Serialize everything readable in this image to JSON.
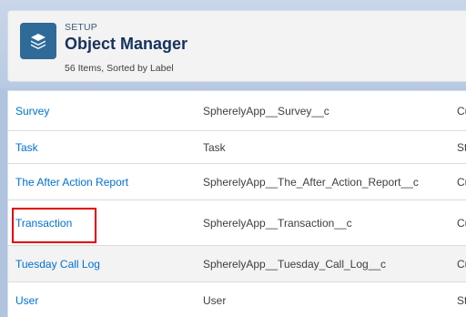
{
  "header": {
    "setup_label": "SETUP",
    "title": "Object Manager",
    "item_count": "56 Items, Sorted by Label",
    "icon": "layers-icon",
    "icon_color": "#2f6a98"
  },
  "rows": [
    {
      "label": "Survey",
      "api_name": "SpherelyApp__Survey__c",
      "type": "Cu"
    },
    {
      "label": "Task",
      "api_name": "Task",
      "type": "St"
    },
    {
      "label": "The After Action Report",
      "api_name": "SpherelyApp__The_After_Action_Report__c",
      "type": "Cu"
    },
    {
      "label": "Transaction",
      "api_name": "SpherelyApp__Transaction__c",
      "type": "Cu"
    },
    {
      "label": "Tuesday Call Log",
      "api_name": "SpherelyApp__Tuesday_Call_Log__c",
      "type": "Cu"
    },
    {
      "label": "User",
      "api_name": "User",
      "type": "St"
    }
  ],
  "colors": {
    "link": "#0070d2",
    "title": "#16325c",
    "highlight": "#e00000"
  }
}
